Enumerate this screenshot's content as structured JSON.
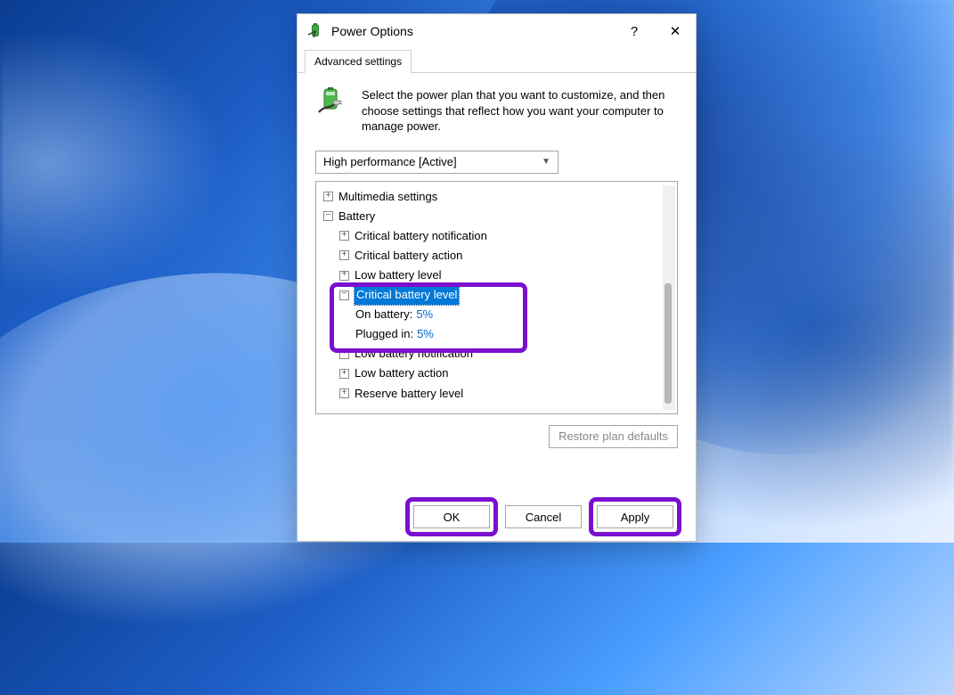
{
  "titlebar": {
    "title": "Power Options",
    "help_symbol": "?",
    "close_symbol": "✕"
  },
  "tabs": {
    "advanced": "Advanced settings"
  },
  "intro": {
    "text": "Select the power plan that you want to customize, and then choose settings that reflect how you want your computer to manage power."
  },
  "plan_select": {
    "value": "High performance [Active]"
  },
  "tree": {
    "multimedia": "Multimedia settings",
    "battery": "Battery",
    "crit_notif": "Critical battery notification",
    "crit_action": "Critical battery action",
    "low_level": "Low battery level",
    "crit_level": "Critical battery level",
    "on_batt_label": "On battery:",
    "on_batt_val": "5%",
    "plugged_label": "Plugged in:",
    "plugged_val": "5%",
    "low_notif": "Low battery notification",
    "low_action": "Low battery action",
    "reserve": "Reserve battery level"
  },
  "buttons": {
    "restore": "Restore plan defaults",
    "ok": "OK",
    "cancel": "Cancel",
    "apply": "Apply"
  }
}
